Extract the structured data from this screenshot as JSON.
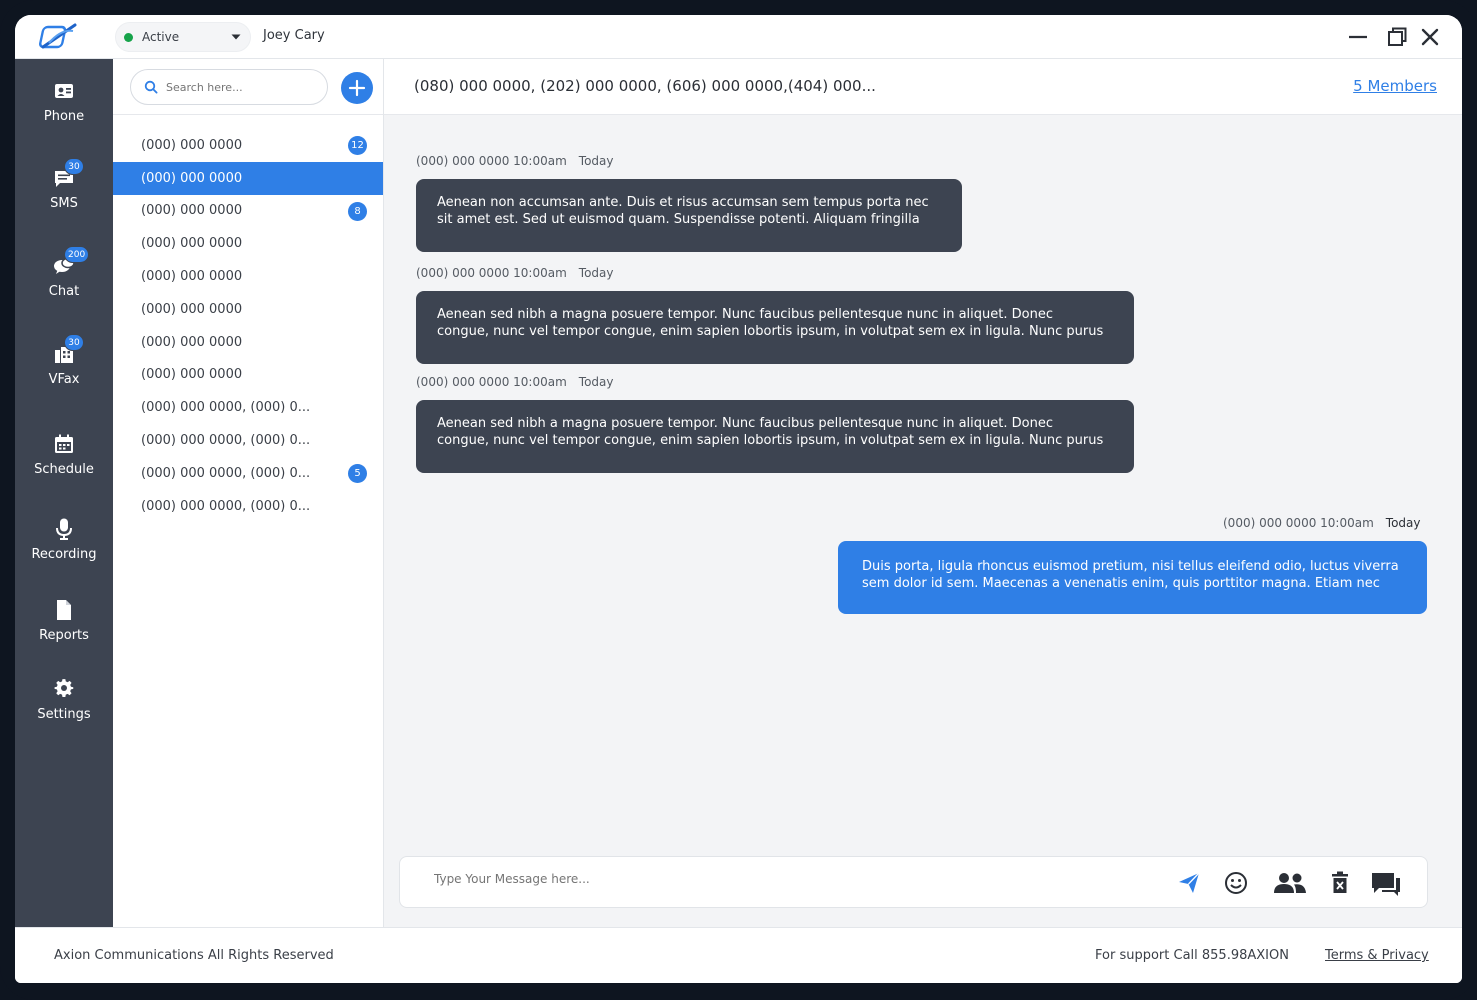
{
  "header": {
    "status_label": "Active",
    "user_name": "Joey Cary"
  },
  "nav": {
    "items": [
      {
        "label": "Phone",
        "icon": "phone-contact-icon",
        "badge": ""
      },
      {
        "label": "SMS",
        "icon": "sms-icon",
        "badge": "30"
      },
      {
        "label": "Chat",
        "icon": "chat-icon",
        "badge": "200"
      },
      {
        "label": "VFax",
        "icon": "fax-icon",
        "badge": "30"
      },
      {
        "label": "Schedule",
        "icon": "calendar-icon",
        "badge": ""
      },
      {
        "label": "Recording",
        "icon": "microphone-icon",
        "badge": ""
      },
      {
        "label": "Reports",
        "icon": "document-icon",
        "badge": ""
      },
      {
        "label": "Settings",
        "icon": "gear-icon",
        "badge": ""
      }
    ]
  },
  "search": {
    "placeholder": "Search here..."
  },
  "contacts": [
    {
      "label": "(000) 000 0000",
      "badge": "12"
    },
    {
      "label": "(000) 000 0000",
      "badge": ""
    },
    {
      "label": "(000) 000 0000",
      "badge": "8"
    },
    {
      "label": "(000) 000 0000",
      "badge": ""
    },
    {
      "label": "(000) 000 0000",
      "badge": ""
    },
    {
      "label": "(000) 000 0000",
      "badge": ""
    },
    {
      "label": "(000) 000 0000",
      "badge": ""
    },
    {
      "label": "(000) 000 0000",
      "badge": ""
    },
    {
      "label": "(000) 000 0000, (000) 0...",
      "badge": ""
    },
    {
      "label": "(000) 000 0000, (000) 0...",
      "badge": ""
    },
    {
      "label": "(000) 000 0000, (000) 0...",
      "badge": "5"
    },
    {
      "label": "(000) 000 0000, (000) 0...",
      "badge": ""
    }
  ],
  "chat": {
    "title": "(080) 000 0000, (202) 000 0000, (606) 000 0000,(404) 000...",
    "members_label": "5 Members",
    "messages": [
      {
        "sender": "(000) 000 0000 10:00am",
        "day": "Today",
        "line1": "Aenean non accumsan ante. Duis et risus accumsan sem tempus porta nec",
        "line2": "sit amet est. Sed ut euismod quam. Suspendisse potenti. Aliquam fringilla",
        "outgoing": false
      },
      {
        "sender": "(000) 000 0000 10:00am",
        "day": "Today",
        "line1": "Aenean sed nibh a magna posuere tempor. Nunc faucibus pellentesque nunc in aliquet. Donec",
        "line2": "congue, nunc vel tempor congue, enim sapien lobortis ipsum, in volutpat sem ex in ligula. Nunc purus",
        "outgoing": false
      },
      {
        "sender": "(000) 000 0000 10:00am",
        "day": "Today",
        "line1": "Aenean sed nibh a magna posuere tempor. Nunc faucibus pellentesque nunc in aliquet. Donec",
        "line2": "congue, nunc vel tempor congue, enim sapien lobortis ipsum, in volutpat sem ex in ligula. Nunc purus",
        "outgoing": false
      },
      {
        "sender": "(000) 000 0000 10:00am",
        "day": "Today",
        "line1": "Duis porta, ligula rhoncus euismod pretium, nisi tellus eleifend odio, luctus viverra",
        "line2": "sem dolor id sem. Maecenas a venenatis enim, quis porttitor magna. Etiam nec",
        "outgoing": true
      }
    ]
  },
  "composer": {
    "placeholder": "Type Your Message here...",
    "buttons": [
      "send-icon",
      "emoji-icon",
      "group-icon",
      "delete-icon",
      "chat-bubbles-icon"
    ]
  },
  "footer": {
    "copyright": "Axion Communications All Rights Reserved",
    "support": "For support Call 855.98AXION",
    "terms": "Terms & Privacy"
  },
  "colors": {
    "accent": "#2f7fe6",
    "nav_bg": "#3d4451",
    "status_active": "#16a34a"
  }
}
